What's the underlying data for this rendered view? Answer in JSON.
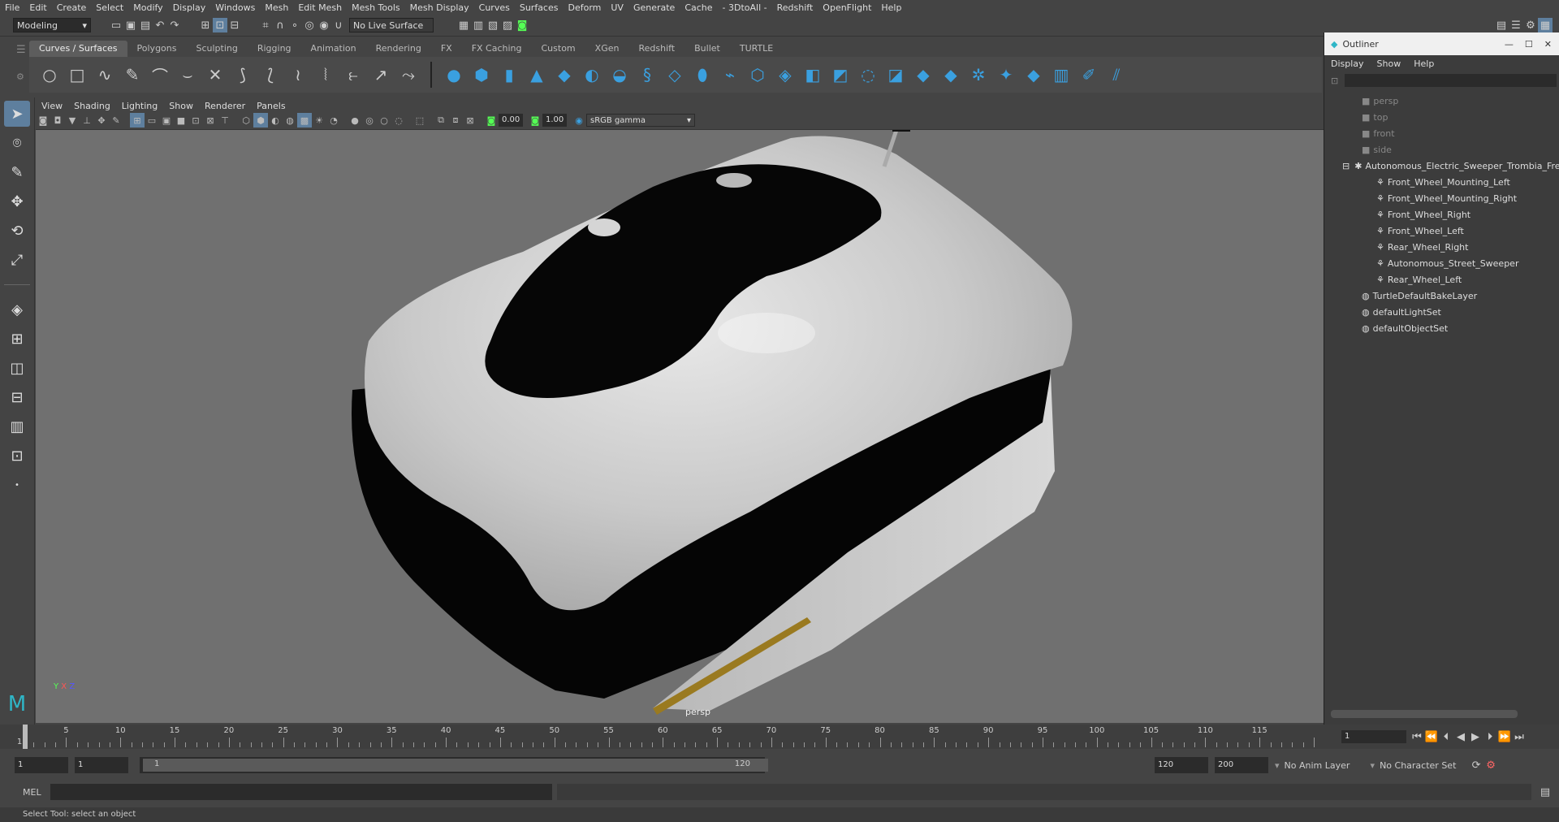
{
  "menubar": [
    "File",
    "Edit",
    "Create",
    "Select",
    "Modify",
    "Display",
    "Windows",
    "Mesh",
    "Edit Mesh",
    "Mesh Tools",
    "Mesh Display",
    "Curves",
    "Surfaces",
    "Deform",
    "UV",
    "Generate",
    "Cache",
    "- 3DtoAll -",
    "Redshift",
    "OpenFlight",
    "Help"
  ],
  "status": {
    "mode": "Modeling",
    "live_surface": "No Live Surface"
  },
  "shelf_tabs": [
    "Curves / Surfaces",
    "Polygons",
    "Sculpting",
    "Rigging",
    "Animation",
    "Rendering",
    "FX",
    "FX Caching",
    "Custom",
    "XGen",
    "Redshift",
    "Bullet",
    "TURTLE"
  ],
  "viewport": {
    "menu": [
      "View",
      "Shading",
      "Lighting",
      "Show",
      "Renderer",
      "Panels"
    ],
    "exposure": "0.00",
    "gamma": "1.00",
    "color_space": "sRGB gamma",
    "camera_label": "persp"
  },
  "outliner": {
    "title": "Outliner",
    "menu": [
      "Display",
      "Show",
      "Help"
    ],
    "cameras": [
      "persp",
      "top",
      "front",
      "side"
    ],
    "root": "Autonomous_Electric_Sweeper_Trombia_Fre",
    "children": [
      "Front_Wheel_Mounting_Left",
      "Front_Wheel_Mounting_Right",
      "Front_Wheel_Right",
      "Front_Wheel_Left",
      "Rear_Wheel_Right",
      "Autonomous_Street_Sweeper",
      "Rear_Wheel_Left"
    ],
    "sets": [
      "TurtleDefaultBakeLayer",
      "defaultLightSet",
      "defaultObjectSet"
    ]
  },
  "timeline": {
    "ticks": [
      "5",
      "10",
      "15",
      "20",
      "25",
      "30",
      "35",
      "40",
      "45",
      "50",
      "55",
      "60",
      "65",
      "70",
      "75",
      "80",
      "85",
      "90",
      "95",
      "100",
      "105",
      "110",
      "115",
      "1"
    ],
    "current_frame": "1",
    "frame_field": "1"
  },
  "range": {
    "start": "1",
    "start2": "1",
    "slider_start": "1",
    "slider_end": "120",
    "end": "120",
    "end2": "200",
    "anim_layer": "No Anim Layer",
    "char_set": "No Character Set"
  },
  "cmd": {
    "lang": "MEL"
  },
  "help_text": "Select Tool: select an object",
  "colors": {
    "accent": "#5e7f9e",
    "viewport_bg": "#707070"
  }
}
